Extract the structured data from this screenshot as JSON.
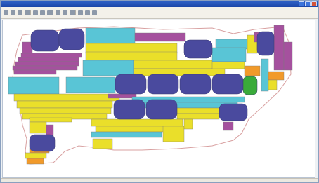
{
  "window": {
    "title": "",
    "status_text": ""
  },
  "toolbar": {
    "tools": [
      "tool",
      "tool",
      "tool",
      "tool",
      "tool",
      "tool",
      "tool",
      "tool",
      "tool",
      "tool",
      "tool",
      "tool",
      "tool"
    ]
  },
  "colors": {
    "indigo": "#4a4a9e",
    "cyan": "#59c5d6",
    "yellow": "#eadf2a",
    "magenta": "#a5519e",
    "lime": "#b4d64a",
    "green": "#3aab3a",
    "orange": "#f19a2a",
    "outline": "#d8a0a0"
  }
}
